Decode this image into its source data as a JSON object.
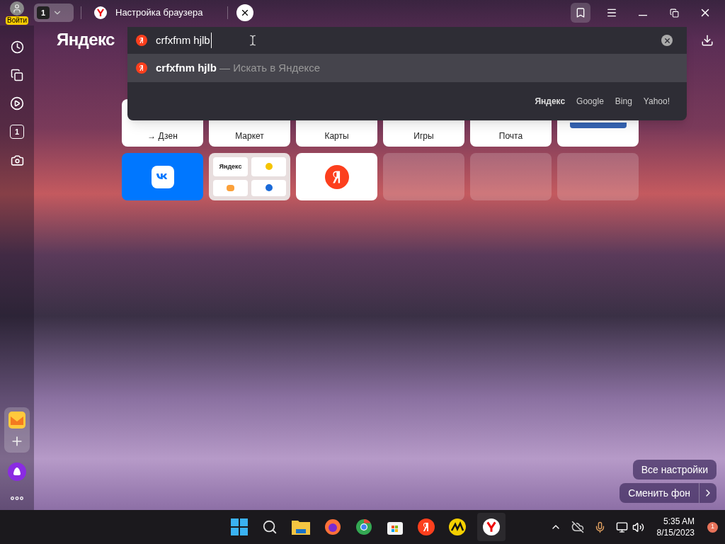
{
  "top_bar": {
    "login_badge": "Войти",
    "tab_count": "1",
    "tab": {
      "title": "Настройка браузера"
    }
  },
  "sidebar": {
    "counter": "1"
  },
  "brand": "Яндекс",
  "search": {
    "value": "crfxfnm hjlb",
    "suggestion": {
      "query": "crfxfnm hjlb",
      "hint": "— Искать в Яндексе"
    },
    "engines": [
      {
        "label": "Яндекс",
        "selected": true
      },
      {
        "label": "Google",
        "selected": false
      },
      {
        "label": "Bing",
        "selected": false
      },
      {
        "label": "Yahoo!",
        "selected": false
      }
    ]
  },
  "tiles": [
    {
      "kind": "site",
      "label": "→ Дзен"
    },
    {
      "kind": "site",
      "label": "Маркет"
    },
    {
      "kind": "site",
      "label": "Карты"
    },
    {
      "kind": "site",
      "label": "Игры"
    },
    {
      "kind": "site",
      "label": "Почта"
    },
    {
      "kind": "logo"
    },
    {
      "kind": "vk"
    },
    {
      "kind": "folder",
      "label": "Яндекс"
    },
    {
      "kind": "ya"
    },
    {
      "kind": "empty"
    },
    {
      "kind": "empty"
    },
    {
      "kind": "empty"
    }
  ],
  "buttons": [
    "Все настройки",
    "Сменить фон"
  ],
  "taskbar": {
    "time": "5:35 AM",
    "date": "8/15/2023",
    "notifications": "1"
  }
}
